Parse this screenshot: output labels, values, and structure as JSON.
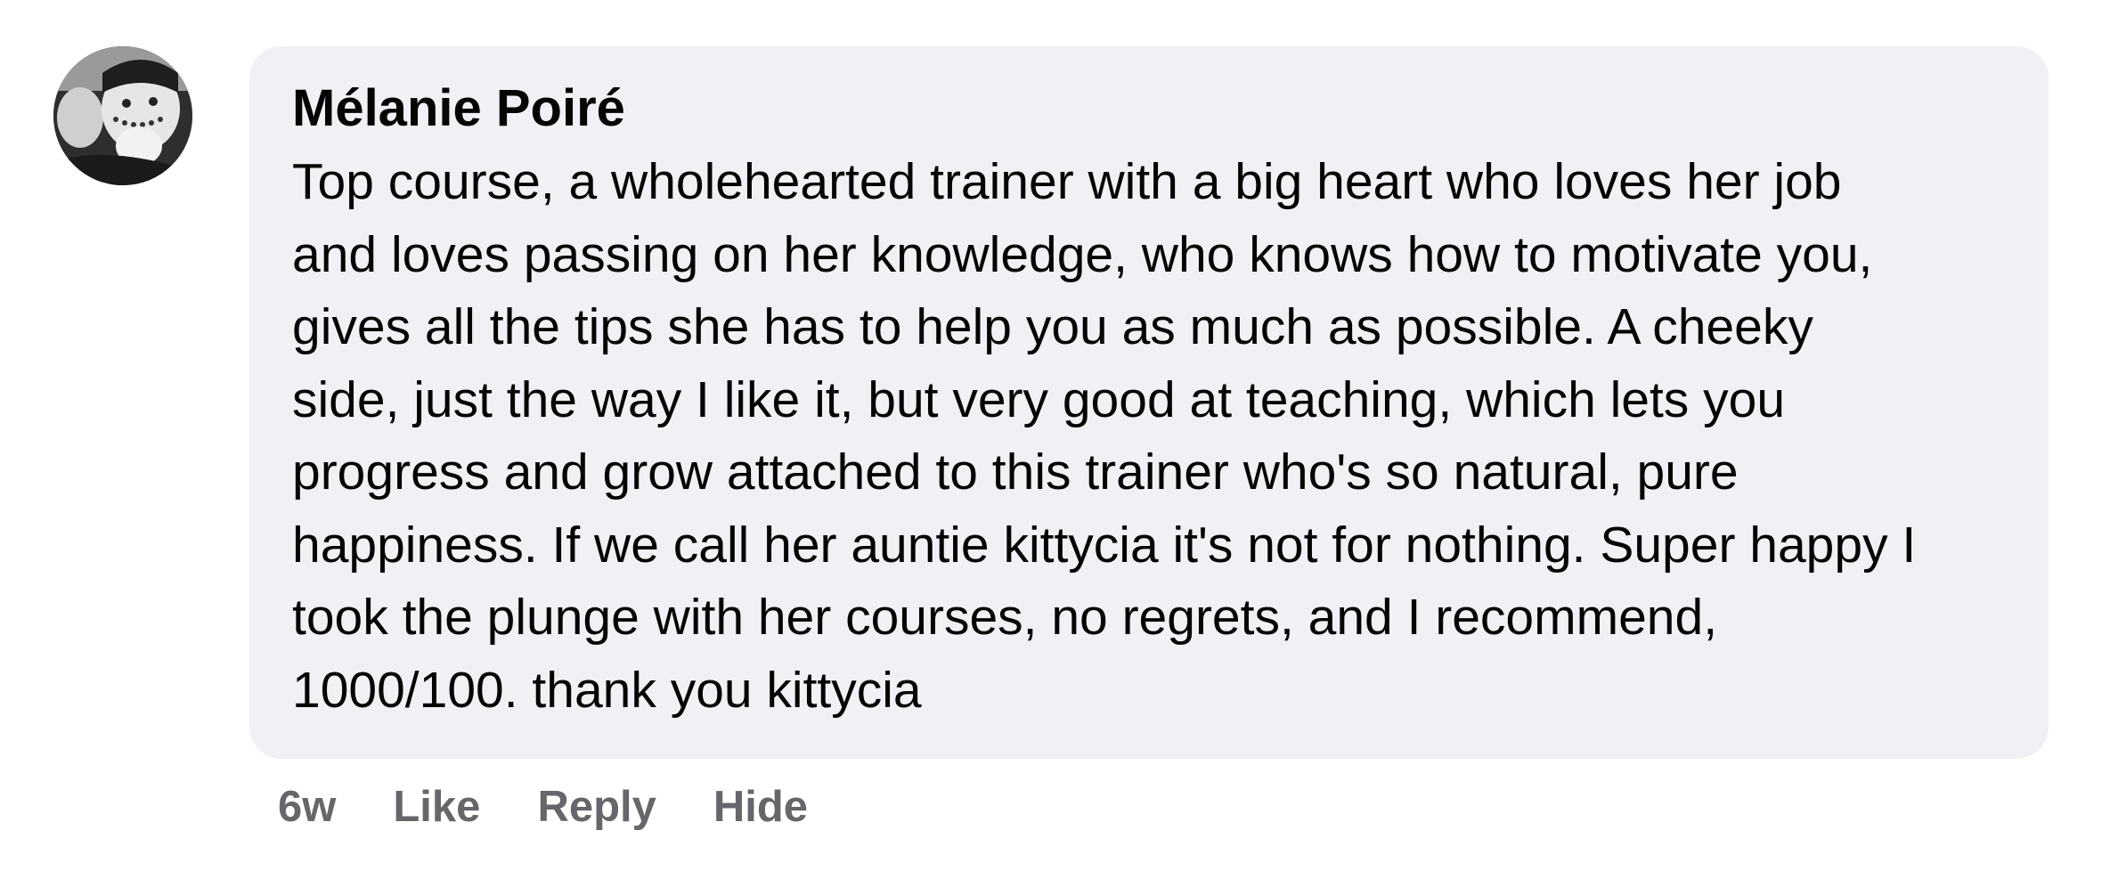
{
  "comment": {
    "author": "Mélanie Poiré",
    "avatar_icon": "profile-photo",
    "lines": [
      "Top course, a wholehearted trainer with a big heart who loves her job",
      "and loves passing on her knowledge, who knows how to motivate you,",
      "gives all the tips she has to help you as much as possible. A cheeky",
      "side, just the way I like it, but very good at teaching, which lets you",
      "progress and grow attached to this trainer who's so natural, pure",
      "happiness. If we call her auntie kittycia it's not for nothing. Super happy I",
      "took the plunge with her courses, no regrets, and I recommend,",
      "1000/100. thank you kittycia"
    ]
  },
  "actions": {
    "timestamp": "6w",
    "like": "Like",
    "reply": "Reply",
    "hide": "Hide"
  },
  "colors": {
    "bubble": "#f0f1f5",
    "text": "#050505",
    "secondary": "#65676b"
  }
}
